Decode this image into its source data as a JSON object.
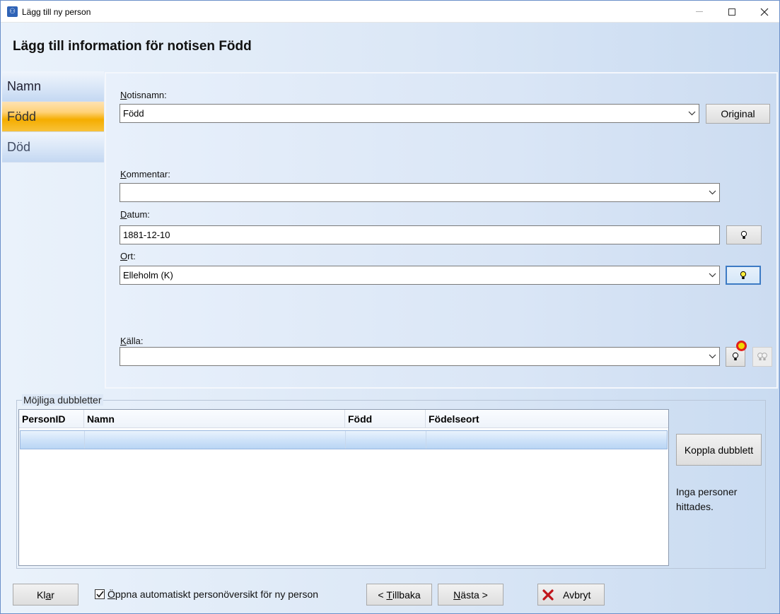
{
  "window": {
    "title": "Lägg till ny person",
    "icon": "app-icon",
    "controls": [
      "minimize-icon",
      "maximize-icon",
      "close-icon"
    ]
  },
  "header": {
    "title": "Lägg till information för notisen Född"
  },
  "sidebar": {
    "items": [
      {
        "label": "Namn",
        "active": false
      },
      {
        "label": "Född",
        "active": true
      },
      {
        "label": "Död",
        "active": false
      }
    ]
  },
  "form": {
    "notisnamn": {
      "label_ul": "N",
      "label_rest": "otisnamn:",
      "value": "Född"
    },
    "original_button": "Original",
    "kommentar": {
      "label_ul": "K",
      "label_rest": "ommentar:",
      "value": ""
    },
    "datum": {
      "label_ul": "D",
      "label_rest": "atum:",
      "value": "1881-12-10"
    },
    "ort": {
      "label_ul": "O",
      "label_rest": "rt:",
      "value": "Elleholm (K)"
    },
    "kalla": {
      "label_ul": "K",
      "label_rest": "älla:",
      "value": ""
    }
  },
  "duplicates": {
    "title": "Möjliga dubbletter",
    "columns": [
      "PersonID",
      "Namn",
      "Född",
      "Födelseort"
    ],
    "rows": [],
    "connect_button": "Koppla dubblett",
    "status": "Inga personer hittades."
  },
  "footer": {
    "done_pre": "Kl",
    "done_ul": "a",
    "done_post": "r",
    "auto_open_checked": true,
    "auto_open_ul": "Ö",
    "auto_open_rest": "ppna automatiskt personöversikt för ny person",
    "back_pre": "< ",
    "back_ul": "T",
    "back_post": "illbaka",
    "next_ul": "N",
    "next_post": "ästa >",
    "cancel": "Avbryt"
  },
  "colors": {
    "active_tab": "#f5ad00",
    "focus_border": "#3d7bc4",
    "cancel_icon": "#c0151b",
    "badge_ring": "#e0201c",
    "badge_fill": "#f1d800"
  }
}
